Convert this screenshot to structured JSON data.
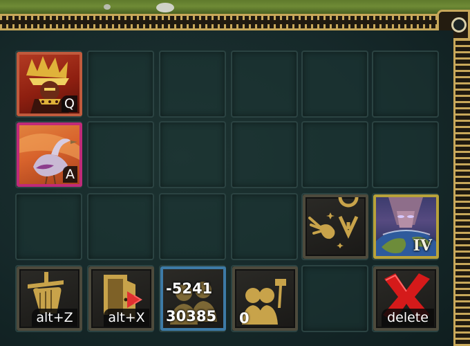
{
  "colors": {
    "panel": "#16292a",
    "gold": "#c8a85a",
    "leader_border": "#c15a3c",
    "unit_border": "#c02a78",
    "stat_border": "#3d7aa6",
    "wonder_border": "#b8a23a",
    "delete_red": "#d51a1a"
  },
  "commands": {
    "leader": {
      "icon": "feathered-leader-portrait",
      "hotkey": "Q"
    },
    "unit": {
      "icon": "bird-unit-portrait",
      "hotkey": "A"
    },
    "comet": {
      "icon": "comet-marker-icon"
    },
    "age_up": {
      "icon": "earth-god-portrait",
      "level": "IV"
    },
    "garrison": {
      "icon": "sword-hand-icon",
      "hotkey": "alt+Z"
    },
    "eject": {
      "icon": "door-exit-icon",
      "hotkey": "alt+X"
    },
    "population": {
      "icon": "people-stat-icon",
      "line1": "-5241",
      "line2": "30385"
    },
    "workers": {
      "icon": "worker-hammer-icon",
      "count": "0"
    },
    "delete": {
      "icon": "red-x-delete-icon",
      "hotkey": "delete"
    }
  }
}
